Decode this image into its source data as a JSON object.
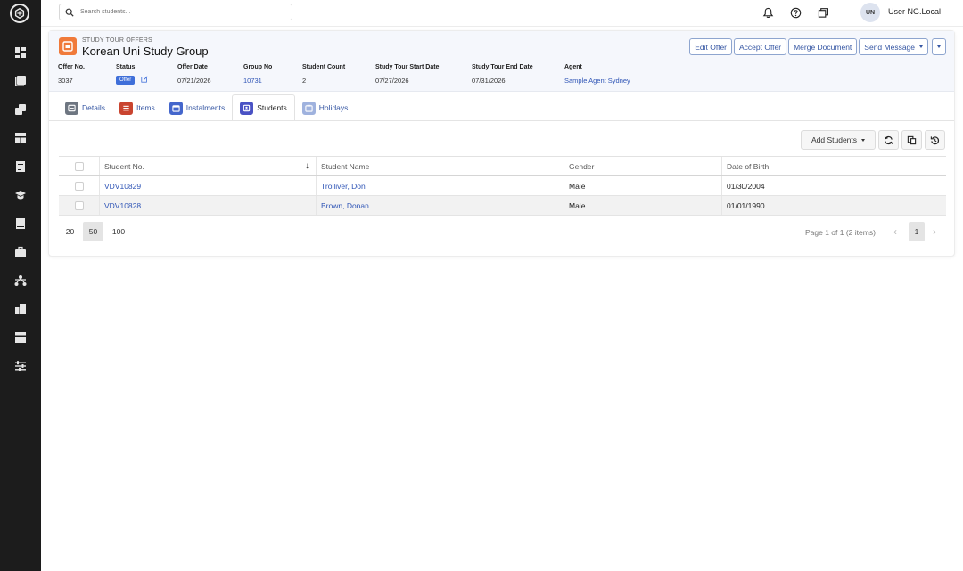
{
  "sidebar": {
    "items": [
      {
        "icon": "dashboard-icon"
      },
      {
        "icon": "contacts-icon"
      },
      {
        "icon": "layers-icon"
      },
      {
        "icon": "layout-icon"
      },
      {
        "icon": "invoice-icon"
      },
      {
        "icon": "graduation-cap-icon"
      },
      {
        "icon": "book-icon"
      },
      {
        "icon": "briefcase-icon"
      },
      {
        "icon": "network-icon"
      },
      {
        "icon": "building-icon"
      },
      {
        "icon": "template-icon"
      },
      {
        "icon": "sliders-icon"
      }
    ]
  },
  "topbar": {
    "search_placeholder": "Search students...",
    "avatar_initials": "UN",
    "username": "User NG.Local"
  },
  "offer": {
    "overline": "STUDY TOUR OFFERS",
    "title": "Korean Uni Study Group",
    "actions": {
      "edit": "Edit Offer",
      "accept": "Accept Offer",
      "merge": "Merge Document",
      "send": "Send Message"
    },
    "fields": {
      "offer_no_label": "Offer No.",
      "offer_no": "3037",
      "status_label": "Status",
      "status": "Offer",
      "offer_date_label": "Offer Date",
      "offer_date": "07/21/2026",
      "group_no_label": "Group No",
      "group_no": "10731",
      "student_count_label": "Student Count",
      "student_count": "2",
      "start_label": "Study Tour Start Date",
      "start": "07/27/2026",
      "end_label": "Study Tour End Date",
      "end": "07/31/2026",
      "agent_label": "Agent",
      "agent": "Sample Agent Sydney"
    }
  },
  "tabs": [
    {
      "label": "Details",
      "color": "#6e7681"
    },
    {
      "label": "Items",
      "color": "#c9442f"
    },
    {
      "label": "Instalments",
      "color": "#4466cc"
    },
    {
      "label": "Students",
      "color": "#4a52c4"
    },
    {
      "label": "Holidays",
      "color": "#9fb2de"
    }
  ],
  "toolbar": {
    "add_students": "Add Students"
  },
  "grid": {
    "columns": [
      "Student No.",
      "Student Name",
      "Gender",
      "Date of Birth"
    ],
    "rows": [
      {
        "student_no": "VDV10829",
        "name": "Trolliver, Don",
        "gender": "Male",
        "dob": "01/30/2004"
      },
      {
        "student_no": "VDV10828",
        "name": "Brown, Donan",
        "gender": "Male",
        "dob": "01/01/1990"
      }
    ]
  },
  "pager": {
    "sizes": [
      "20",
      "50",
      "100"
    ],
    "active_size": "50",
    "info": "Page 1 of 1 (2 items)",
    "page": "1"
  }
}
